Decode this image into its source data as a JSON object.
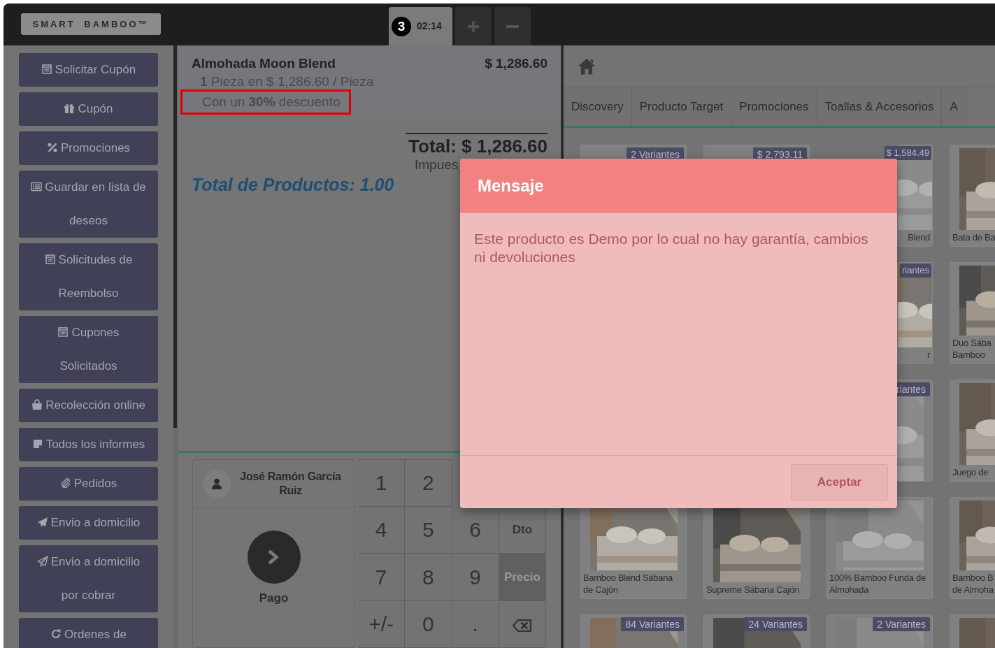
{
  "logo": {
    "text": "SMART BAMBOO™"
  },
  "orders": [
    {
      "number": "3",
      "time": "02:14",
      "selected": true
    }
  ],
  "sidebar": {
    "items": [
      {
        "label": "Solicitar Cupón"
      },
      {
        "label": "Cupón"
      },
      {
        "label": "Promociones"
      },
      {
        "label": "Guardar en lista de\ndeseos"
      },
      {
        "label": "Solicitudes de\nReembolso"
      },
      {
        "label": "Cupones\nSolicitados"
      },
      {
        "label": "Recolección online"
      },
      {
        "label": "Todos los informes"
      },
      {
        "label": "Pedidos"
      },
      {
        "label": "Envio a domicilio"
      },
      {
        "label": "Envio a domicilio\npor cobrar"
      },
      {
        "label": "Ordenes de"
      }
    ]
  },
  "order": {
    "lines": [
      {
        "name": "Almohada Moon Blend",
        "price": "$ 1,286.60",
        "detail": "**1** Pieza en $ 1,286.60 / Pieza",
        "discount": "Con un **30%** descuento",
        "highlighted": true
      }
    ],
    "total": "Total: $ 1,286.60",
    "tax": "Impues",
    "product_count": "Total de Productos: 1.00"
  },
  "customer": {
    "name": "José Ramón García Ruiz"
  },
  "payment": {
    "label": "Pago"
  },
  "keypad": {
    "rows": [
      [
        {
          "kind": "text",
          "label": "1",
          "selected": false
        },
        {
          "kind": "text",
          "label": "2",
          "selected": false
        }
      ],
      [
        {
          "kind": "text",
          "label": "4",
          "selected": false
        },
        {
          "kind": "text",
          "label": "5",
          "selected": false
        },
        {
          "kind": "text",
          "label": "6",
          "selected": false
        },
        {
          "kind": "word",
          "label": "Dto",
          "selected": false
        }
      ],
      [
        {
          "kind": "text",
          "label": "7",
          "selected": false
        },
        {
          "kind": "text",
          "label": "8",
          "selected": false
        },
        {
          "kind": "text",
          "label": "9",
          "selected": false
        },
        {
          "kind": "word",
          "label": "Precio",
          "selected": true
        }
      ],
      [
        {
          "kind": "text",
          "label": "+/-",
          "selected": false
        },
        {
          "kind": "text",
          "label": "0",
          "selected": false
        },
        {
          "kind": "text",
          "label": ".",
          "selected": false
        },
        {
          "kind": "backspace",
          "selected": false
        }
      ]
    ]
  },
  "categories": [
    {
      "label": "Discovery",
      "selected": false
    },
    {
      "label": "Producto Target",
      "selected": false
    },
    {
      "label": "Promociones",
      "selected": false
    },
    {
      "label": "Toallas & Accesorios",
      "selected": false
    },
    {
      "label": "A",
      "selected": false
    }
  ],
  "product_rows": [
    [
      {
        "kind": "plain",
        "badge": "2 Variantes"
      },
      {
        "kind": "plain",
        "badge": "$ 2,793.11"
      },
      {
        "kind": "picture",
        "badge": "$ 1,584.49",
        "name": "Blend",
        "covered": true
      },
      {
        "kind": "picture",
        "name": "Bata de Ba"
      }
    ],
    [
      {
        "kind": "picture",
        "badge": "riantes",
        "name": "r",
        "covered": true
      },
      {
        "kind": "picture",
        "name": "Duo Sába\nBamboo"
      }
    ],
    [
      {
        "kind": "picture",
        "badge": "riantes"
      },
      {
        "kind": "picture",
        "name": "Juego de"
      }
    ],
    [
      {
        "kind": "picture",
        "name": "Bamboo Blend Sábana\nde Cajón"
      },
      {
        "kind": "picture",
        "name": "Supreme Sábana Cajón"
      },
      {
        "kind": "picture",
        "name": "100% Bamboo Funda de\nAlmohada"
      },
      {
        "kind": "picture",
        "name": "Bamboo B\nde Almoha"
      }
    ],
    [
      {
        "kind": "picture",
        "badge": "84 Variantes"
      },
      {
        "kind": "picture",
        "badge": "24 Variantes"
      },
      {
        "kind": "picture",
        "badge": "2 Variantes"
      },
      {
        "kind": "picture"
      }
    ]
  ],
  "modal": {
    "title": "Mensaje",
    "message": "Este producto es Demo por lo cual no hay garantía, cambios ni devoluciones",
    "button": "Aceptar"
  }
}
